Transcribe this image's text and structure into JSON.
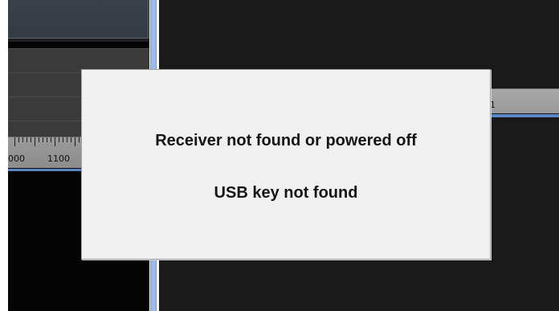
{
  "spectrum_ruler": {
    "left_labels": [
      "000",
      "1100"
    ],
    "right_label": "1"
  },
  "dialog": {
    "messages": [
      "Receiver not found or powered off",
      "USB key not found"
    ]
  },
  "colors": {
    "accent_blue": "#5b86c6",
    "splitter_blue": "#9ebbe6",
    "dialog_background": "#f0f0f0"
  }
}
